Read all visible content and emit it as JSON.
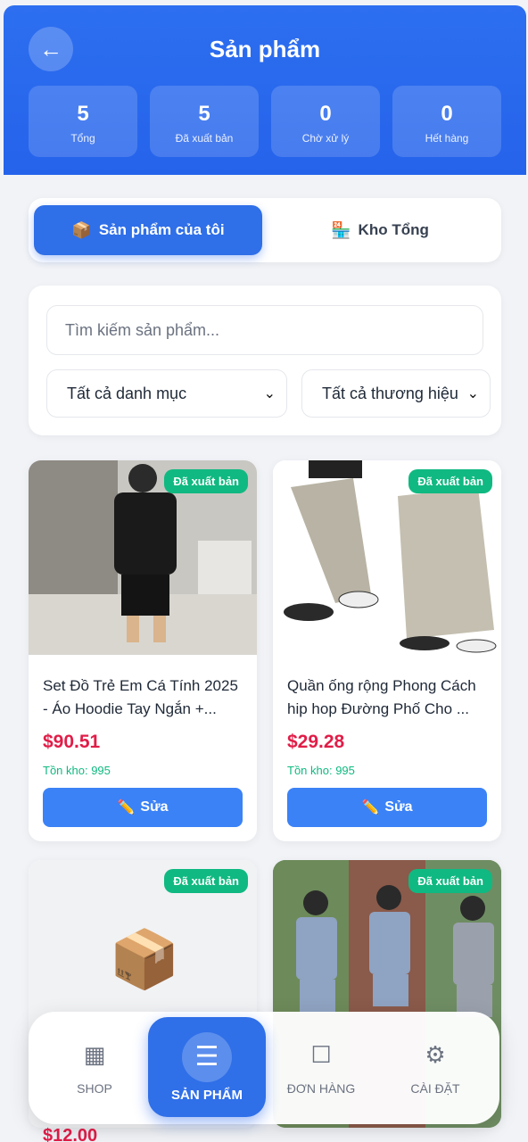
{
  "header": {
    "title": "Sản phẩm",
    "back_icon": "arrow-left-icon",
    "stats": [
      {
        "value": "5",
        "label": "Tổng"
      },
      {
        "value": "5",
        "label": "Đã xuất bản"
      },
      {
        "value": "0",
        "label": "Chờ xử lý"
      },
      {
        "value": "0",
        "label": "Hết hàng"
      }
    ]
  },
  "tabs": [
    {
      "label": "Sản phẩm của tôi",
      "icon": "box-icon"
    },
    {
      "label": "Kho Tổng",
      "icon": "warehouse-icon"
    }
  ],
  "filters": {
    "search_placeholder": "Tìm kiếm sản phẩm...",
    "category": "Tất cả danh mục",
    "brand": "Tất cả thương hiệu"
  },
  "products": [
    {
      "badge": "Đã xuất bản",
      "name": "Set Đồ Trẻ Em Cá Tính 2025 - Áo Hoodie Tay Ngắn +...",
      "price": "$90.51",
      "stock": "Tồn kho: 995",
      "edit": "Sửa"
    },
    {
      "badge": "Đã xuất bản",
      "name": "Quần ống rộng Phong Cách hip hop Đường Phố Cho ...",
      "price": "$29.28",
      "stock": "Tồn kho: 995",
      "edit": "Sửa"
    },
    {
      "badge": "Đã xuất bản",
      "price": "$12.00"
    },
    {
      "badge": "Đã xuất bản"
    }
  ],
  "nav": [
    {
      "label": "SHOP",
      "icon": "grid-icon"
    },
    {
      "label": "SẢN PHẨM",
      "icon": "menu-icon"
    },
    {
      "label": "ĐƠN HÀNG",
      "icon": "square-icon"
    },
    {
      "label": "CÀI ĐẶT",
      "icon": "gear-icon"
    }
  ],
  "colors": {
    "primary": "#2563eb",
    "success": "#10b981",
    "price": "#e11d48"
  }
}
